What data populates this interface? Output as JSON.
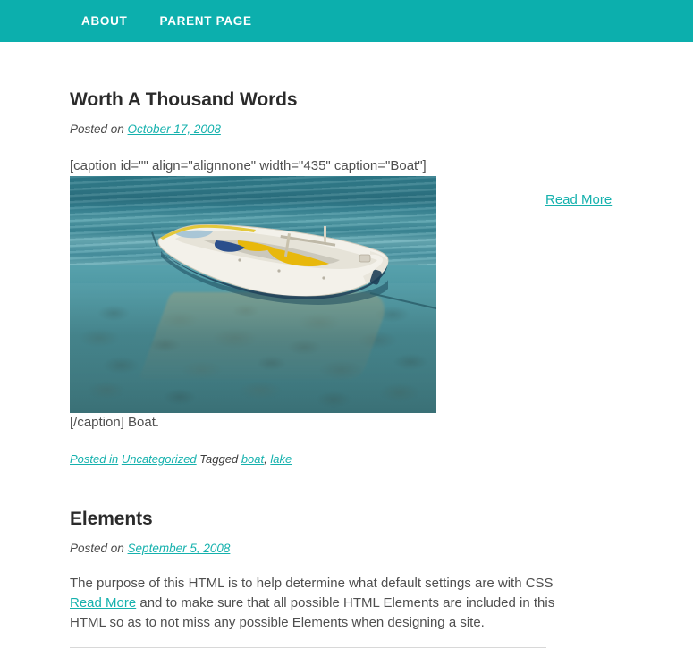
{
  "site": {
    "theme_accent": "#0cafad",
    "link_color": "#15b1ad",
    "heading_color": "#2b2b2b",
    "body_text_color": "#4f4f4f"
  },
  "nav": {
    "items": [
      {
        "label": "ABOUT",
        "name": "nav-item-about"
      },
      {
        "label": "PARENT PAGE",
        "name": "nav-item-parent-page"
      }
    ]
  },
  "posts": [
    {
      "title": "Worth A Thousand Words",
      "meta_prefix": "Posted on ",
      "date": "October 17, 2008",
      "caption_shortcode": "[caption id=\"\" align=\"alignnone\" width=\"435\" caption=\"Boat\"]",
      "image_alt": "Boat",
      "after_image_text": "[/caption] Boat.",
      "read_more": "Read More",
      "footer": {
        "posted_in_label": "Posted in",
        "category": "Uncategorized",
        "tagged_label": "Tagged",
        "tags": [
          "boat",
          "lake"
        ],
        "tag_separator": ","
      }
    },
    {
      "title": "Elements",
      "meta_prefix": "Posted on ",
      "date": "September 5, 2008",
      "excerpt_before": "The purpose of this HTML is to help determine what default settings are with CSS ",
      "read_more": "Read More",
      "excerpt_after": " and to make sure that all possible HTML Elements are included in this HTML so as to not miss any possible Elements when designing a site."
    }
  ]
}
